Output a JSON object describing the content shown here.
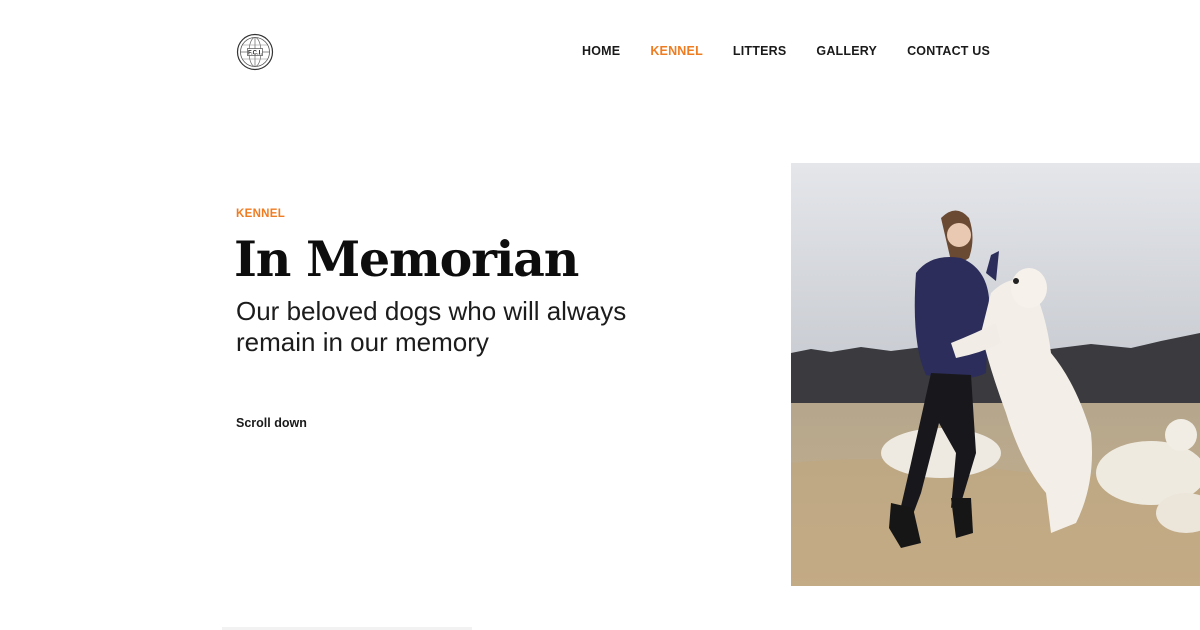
{
  "header": {
    "logo_icon": "fci-globe-logo-icon",
    "nav": [
      {
        "label": "HOME",
        "active": false
      },
      {
        "label": "KENNEL",
        "active": true
      },
      {
        "label": "LITTERS",
        "active": false
      },
      {
        "label": "GALLERY",
        "active": false
      },
      {
        "label": "CONTACT US",
        "active": false
      }
    ]
  },
  "hero": {
    "eyebrow": "KENNEL",
    "title": "In Memorian",
    "subtitle": "Our beloved dogs who will always remain in our memory",
    "scroll_label": "Scroll down",
    "image_alt": "photo-woman-with-white-dogs"
  },
  "colors": {
    "accent": "#f07c22",
    "text": "#111111",
    "background": "#ffffff"
  }
}
